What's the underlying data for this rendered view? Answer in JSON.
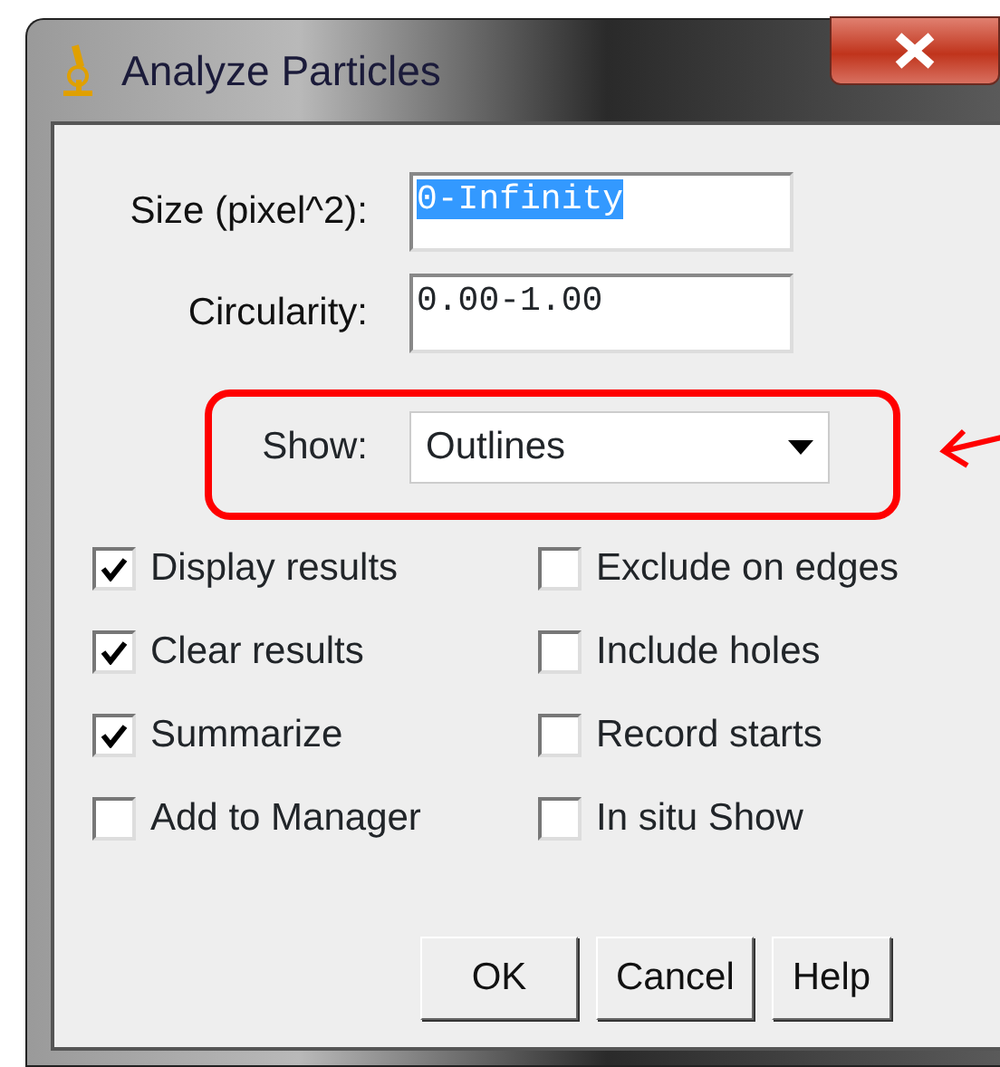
{
  "window": {
    "title": "Analyze Particles"
  },
  "fields": [
    {
      "label": "Size (pixel^2):",
      "value": "0-Infinity",
      "selected": true
    },
    {
      "label": "Circularity:",
      "value": "0.00-1.00",
      "selected": false
    }
  ],
  "show": {
    "label": "Show:",
    "value": "Outlines",
    "highlighted": true
  },
  "checkboxes": [
    {
      "label": "Display results",
      "checked": true
    },
    {
      "label": "Exclude on edges",
      "checked": false
    },
    {
      "label": "Clear results",
      "checked": true
    },
    {
      "label": "Include holes",
      "checked": false
    },
    {
      "label": "Summarize",
      "checked": true
    },
    {
      "label": "Record starts",
      "checked": false
    },
    {
      "label": "Add to Manager",
      "checked": false
    },
    {
      "label": "In situ Show",
      "checked": false
    }
  ],
  "buttons": [
    "OK",
    "Cancel",
    "Help"
  ]
}
